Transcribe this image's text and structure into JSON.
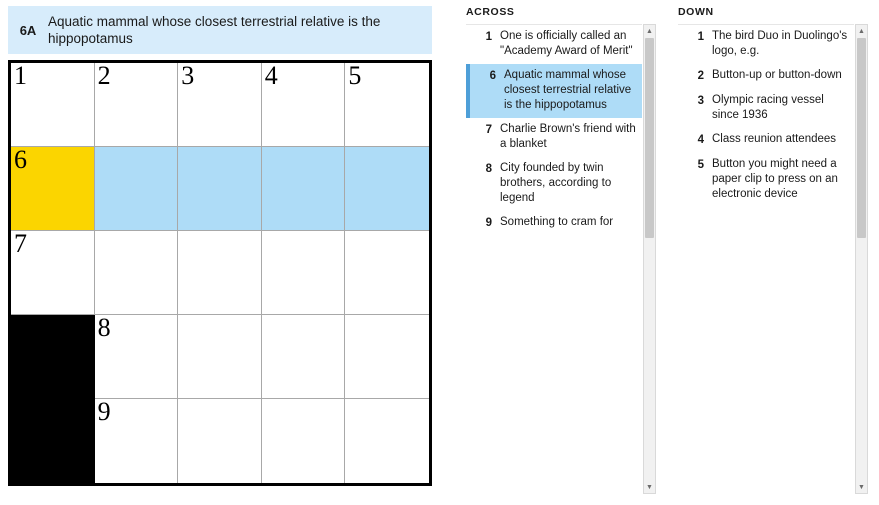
{
  "current_clue": {
    "number": "6A",
    "text": "Aquatic mammal whose closest terrestrial relative is the hippopotamus"
  },
  "grid": {
    "rows": 5,
    "cols": 5,
    "cells": [
      {
        "r": 0,
        "c": 0,
        "number": "1",
        "state": "empty"
      },
      {
        "r": 0,
        "c": 1,
        "number": "2",
        "state": "empty"
      },
      {
        "r": 0,
        "c": 2,
        "number": "3",
        "state": "empty"
      },
      {
        "r": 0,
        "c": 3,
        "number": "4",
        "state": "empty"
      },
      {
        "r": 0,
        "c": 4,
        "number": "5",
        "state": "empty"
      },
      {
        "r": 1,
        "c": 0,
        "number": "6",
        "state": "cursor"
      },
      {
        "r": 1,
        "c": 1,
        "number": "",
        "state": "highlight"
      },
      {
        "r": 1,
        "c": 2,
        "number": "",
        "state": "highlight"
      },
      {
        "r": 1,
        "c": 3,
        "number": "",
        "state": "highlight"
      },
      {
        "r": 1,
        "c": 4,
        "number": "",
        "state": "highlight"
      },
      {
        "r": 2,
        "c": 0,
        "number": "7",
        "state": "empty"
      },
      {
        "r": 2,
        "c": 1,
        "number": "",
        "state": "empty"
      },
      {
        "r": 2,
        "c": 2,
        "number": "",
        "state": "empty"
      },
      {
        "r": 2,
        "c": 3,
        "number": "",
        "state": "empty"
      },
      {
        "r": 2,
        "c": 4,
        "number": "",
        "state": "empty"
      },
      {
        "r": 3,
        "c": 0,
        "number": "",
        "state": "block"
      },
      {
        "r": 3,
        "c": 1,
        "number": "8",
        "state": "empty"
      },
      {
        "r": 3,
        "c": 2,
        "number": "",
        "state": "empty"
      },
      {
        "r": 3,
        "c": 3,
        "number": "",
        "state": "empty"
      },
      {
        "r": 3,
        "c": 4,
        "number": "",
        "state": "empty"
      },
      {
        "r": 4,
        "c": 0,
        "number": "",
        "state": "block"
      },
      {
        "r": 4,
        "c": 1,
        "number": "9",
        "state": "empty"
      },
      {
        "r": 4,
        "c": 2,
        "number": "",
        "state": "empty"
      },
      {
        "r": 4,
        "c": 3,
        "number": "",
        "state": "empty"
      },
      {
        "r": 4,
        "c": 4,
        "number": "",
        "state": "empty"
      }
    ]
  },
  "across": {
    "title": "ACROSS",
    "clues": [
      {
        "number": "1",
        "text": "One is officially called an \"Academy Award of Merit\"",
        "selected": false
      },
      {
        "number": "6",
        "text": "Aquatic mammal whose closest terrestrial relative is the hippopotamus",
        "selected": true
      },
      {
        "number": "7",
        "text": "Charlie Brown's friend with a blanket",
        "selected": false
      },
      {
        "number": "8",
        "text": "City founded by twin brothers, according to legend",
        "selected": false
      },
      {
        "number": "9",
        "text": "Something to cram for",
        "selected": false
      }
    ]
  },
  "down": {
    "title": "DOWN",
    "clues": [
      {
        "number": "1",
        "text": "The bird Duo in Duolingo's logo, e.g.",
        "selected": false
      },
      {
        "number": "2",
        "text": "Button-up or button-down",
        "selected": false
      },
      {
        "number": "3",
        "text": "Olympic racing vessel since 1936",
        "selected": false
      },
      {
        "number": "4",
        "text": "Class reunion attendees",
        "selected": false
      },
      {
        "number": "5",
        "text": "Button you might need a paper clip to press on an electronic device",
        "selected": false
      }
    ]
  },
  "scrollbars": {
    "up_arrow": "▲",
    "down_arrow": "▼"
  },
  "colors": {
    "highlight": "#aedcf7",
    "cursor": "#fbd500",
    "banner": "#d7ecfb",
    "active_marker": "#4e9fd8"
  }
}
